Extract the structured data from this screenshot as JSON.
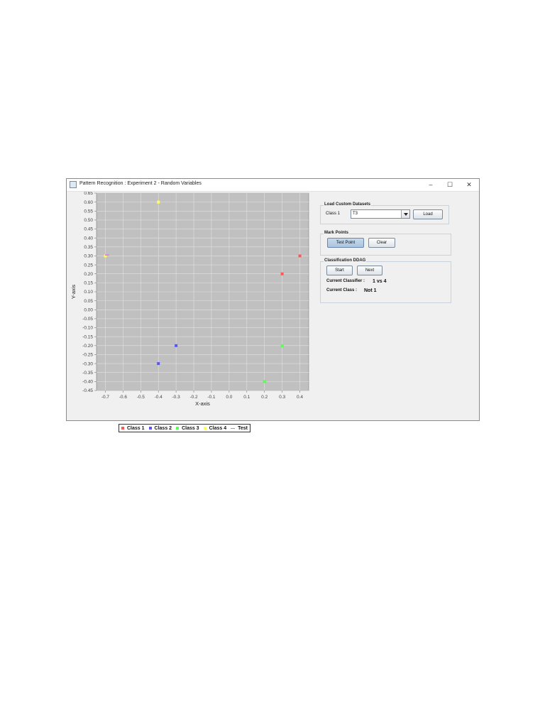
{
  "window": {
    "title": "Pattern Recognition : Experiment 2 - Random Variables",
    "minimize": "–",
    "maximize": "☐",
    "close": "✕"
  },
  "chart_data": {
    "type": "scatter",
    "xlabel": "X-axis",
    "ylabel": "Y-axis",
    "xlim": [
      -0.75,
      0.45
    ],
    "ylim": [
      -0.45,
      0.65
    ],
    "x_ticks": [
      -0.7,
      -0.6,
      -0.5,
      -0.4,
      -0.3,
      -0.2,
      -0.1,
      0.0,
      0.1,
      0.2,
      0.3,
      0.4
    ],
    "y_ticks": [
      0.65,
      0.6,
      0.55,
      0.5,
      0.45,
      0.4,
      0.35,
      0.3,
      0.25,
      0.2,
      0.15,
      0.1,
      0.05,
      0.0,
      -0.05,
      -0.1,
      -0.15,
      -0.2,
      -0.25,
      -0.3,
      -0.35,
      -0.4,
      -0.45
    ],
    "grid": true,
    "legend_position": "bottom",
    "series": [
      {
        "name": "Class 1",
        "color": "#ff5555",
        "points": [
          [
            0.3,
            0.2
          ],
          [
            0.4,
            0.3
          ]
        ]
      },
      {
        "name": "Class 2",
        "color": "#5555ff",
        "points": [
          [
            -0.3,
            -0.2
          ],
          [
            -0.4,
            -0.3
          ]
        ]
      },
      {
        "name": "Class 3",
        "color": "#55ff55",
        "points": [
          [
            0.3,
            -0.2
          ],
          [
            0.2,
            -0.4
          ]
        ]
      },
      {
        "name": "Class 4",
        "color": "#ffff55",
        "points": [
          [
            -0.4,
            0.6
          ],
          [
            -0.7,
            0.3
          ]
        ]
      },
      {
        "name": "Test",
        "color": "#ff55ff",
        "points": [
          [
            -0.69,
            0.305
          ]
        ]
      }
    ]
  },
  "panel": {
    "load": {
      "title": "Load Custom Datasets",
      "class_label": "Class 1",
      "combo_value": "T3",
      "load_button": "Load"
    },
    "mark": {
      "title": "Mark Points",
      "test_point_button": "Test Point",
      "clear_button": "Clear"
    },
    "ddag": {
      "title": "Classification DDAG",
      "start_button": "Start",
      "next_button": "Next",
      "classifier_label": "Current Classifier :",
      "classifier_value": "1 vs 4",
      "class_label": "Current Class :",
      "class_value": "Not 1"
    }
  }
}
